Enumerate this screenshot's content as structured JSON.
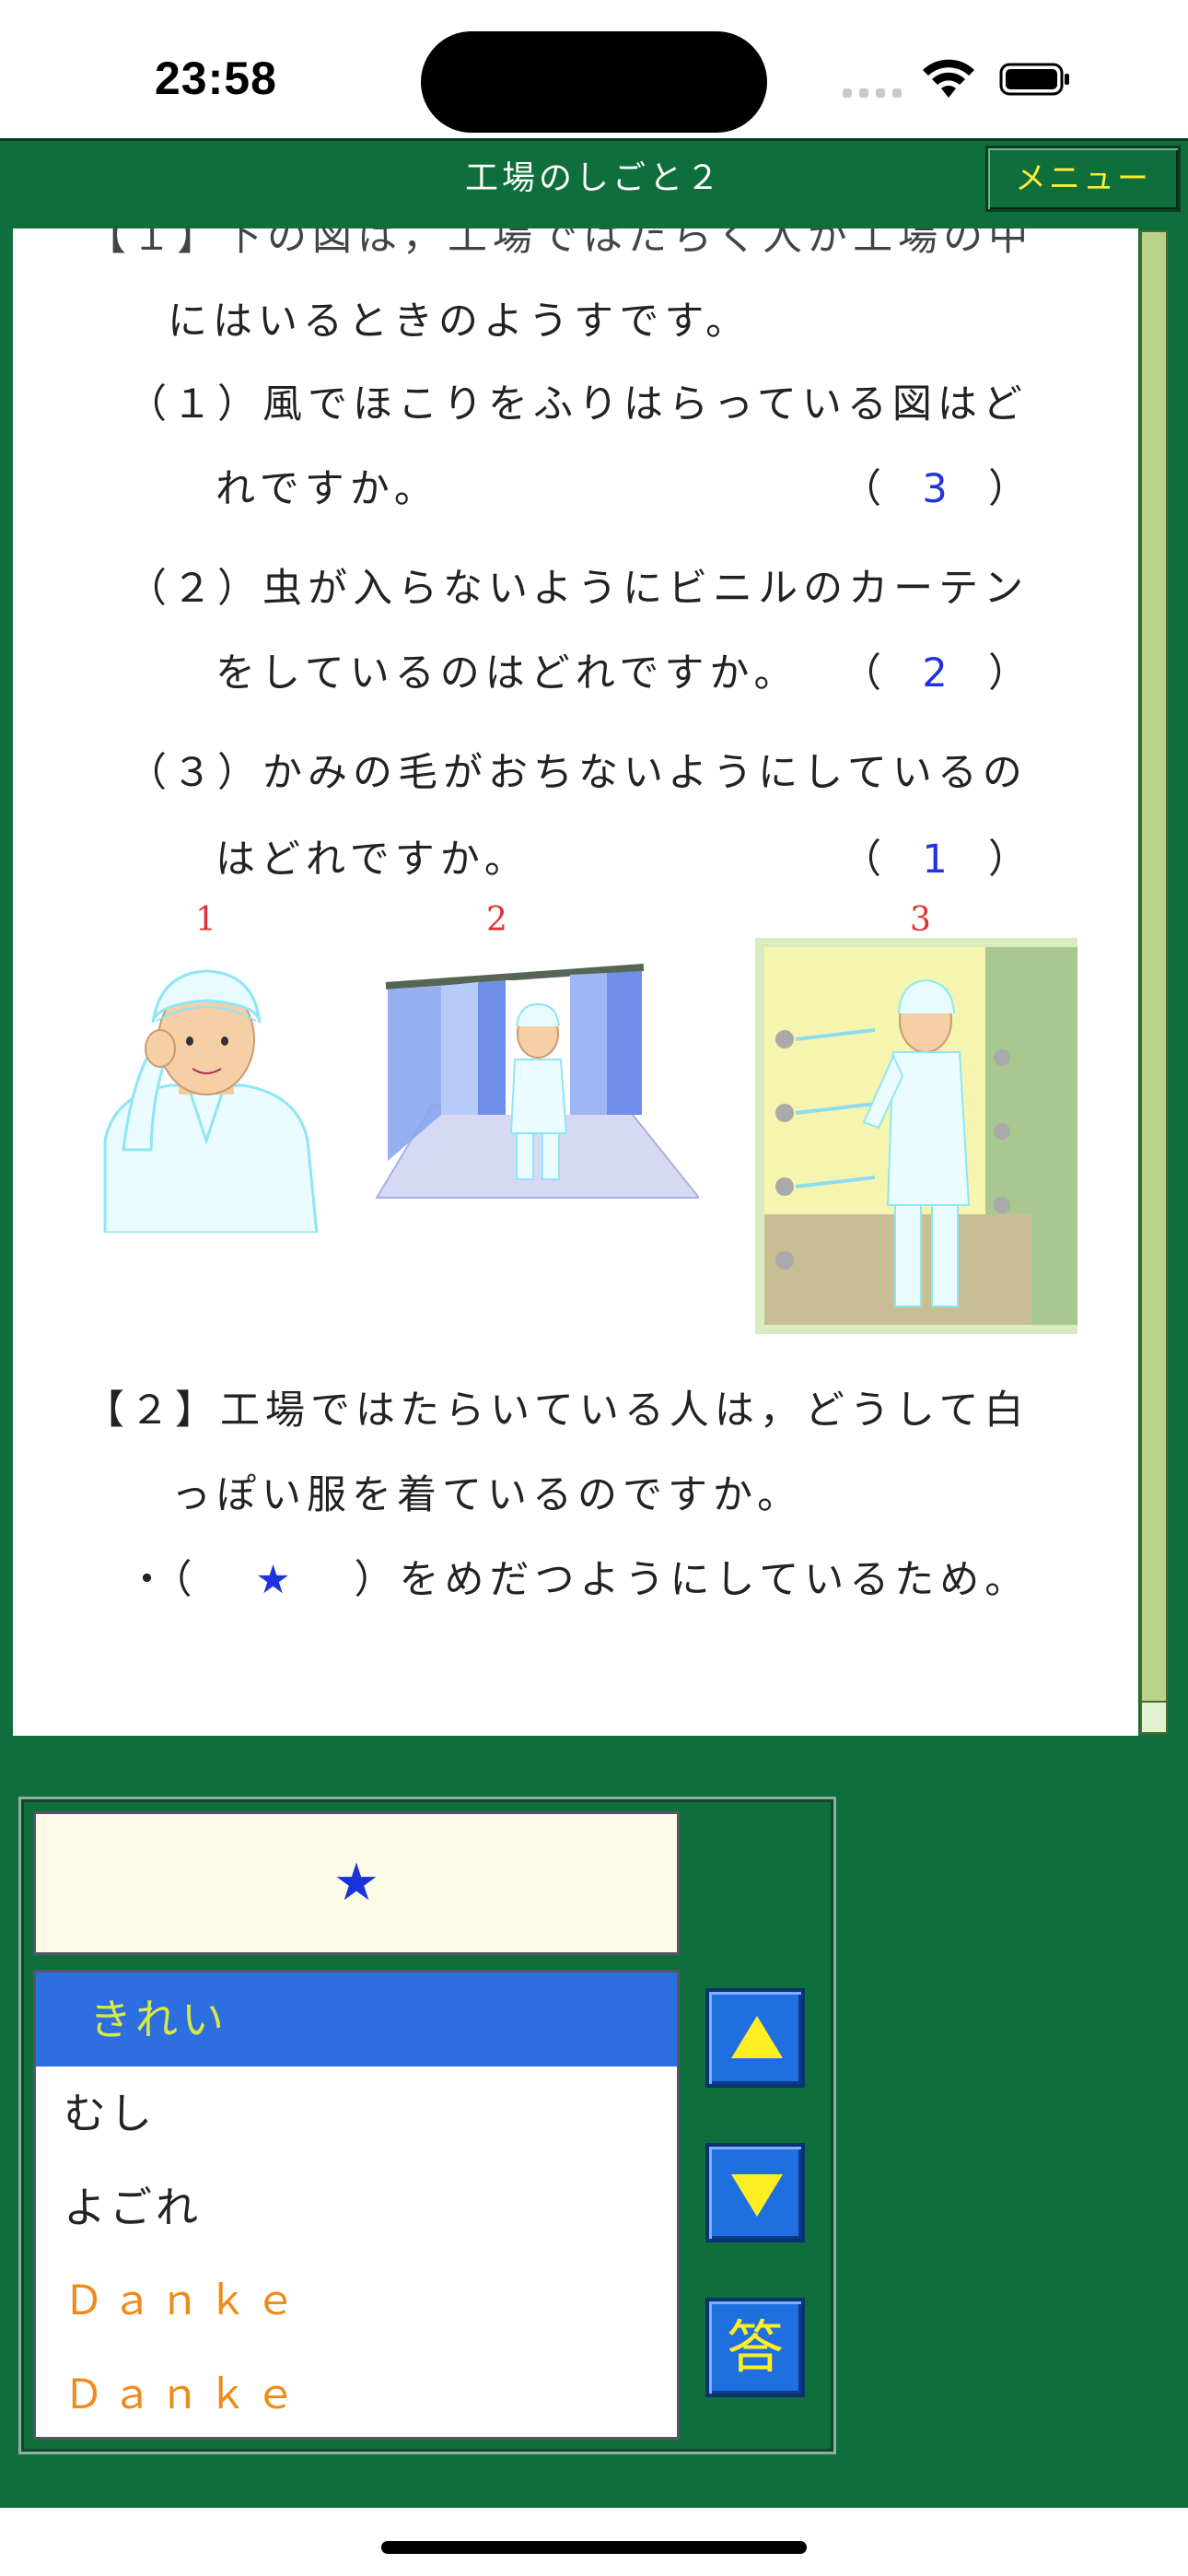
{
  "status": {
    "time": "23:58"
  },
  "header": {
    "title": "工場のしごと２",
    "menu_label": "メニュー"
  },
  "question1": {
    "intro_line": "にはいるときのようすです。",
    "q1_line1": "（１）風でほこりをふりはらっている図はど",
    "q1_line2": "れですか。",
    "q1_answer": "3",
    "q2_line1": "（２）虫が入らないようにビニルのカーテン",
    "q2_line2": "をしているのはどれですか。",
    "q2_answer": "2",
    "q3_line1": "（３）かみの毛がおちないようにしているの",
    "q3_line2": "はどれですか。",
    "q3_answer": "1",
    "paren_open": "（",
    "paren_close": "）",
    "image_labels": [
      "1",
      "2",
      "3"
    ]
  },
  "question2": {
    "line1": "【２】工場ではたらいている人は，どうして白",
    "line2": "っぽい服を着ているのですか。",
    "line3_prefix": "・（",
    "blank": "★",
    "line3_suffix": "）をめだつようにしているため。"
  },
  "answer_input": {
    "value": "★"
  },
  "choices": [
    {
      "label": "きれい",
      "selected": true,
      "color": "#d8e845"
    },
    {
      "label": "むし",
      "selected": false,
      "color": "#222222"
    },
    {
      "label": "よごれ",
      "selected": false,
      "color": "#222222"
    },
    {
      "label": "Ｄａｎｋｅ",
      "selected": false,
      "color": "#f08a1a"
    },
    {
      "label": "Ｄａｎｋｅ",
      "selected": false,
      "color": "#f08a1a"
    }
  ],
  "buttons": {
    "up": "up-arrow",
    "down": "down-arrow",
    "answer_label": "答"
  },
  "colors": {
    "frame": "#0e6e3c",
    "accent_yellow": "#ffee22",
    "answer_blue": "#2233dd",
    "selected_bg": "#2d6fe0"
  }
}
